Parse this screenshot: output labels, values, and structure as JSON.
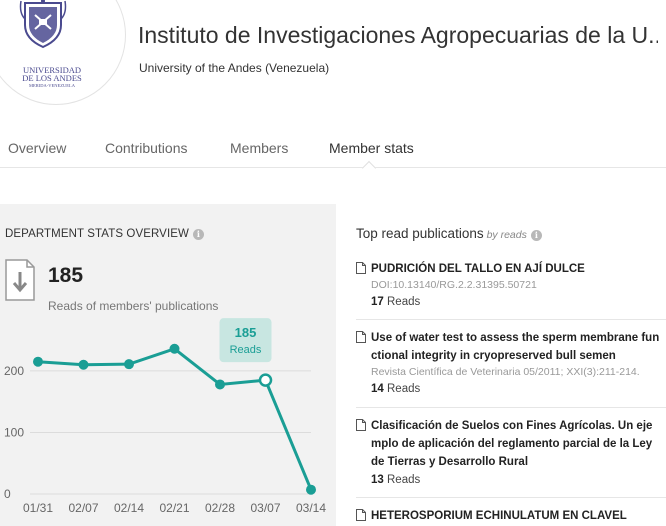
{
  "header": {
    "title": "Instituto de Investigaciones Agropecuarias de la U...",
    "subtitle": "University of the Andes (Venezuela)",
    "logo_text_line1": "UNIVERSIDAD",
    "logo_text_line2": "DE LOS ANDES",
    "logo_text_line3": "MERIDA-VENEZUELA"
  },
  "tabs": [
    {
      "label": "Overview"
    },
    {
      "label": "Contributions"
    },
    {
      "label": "Members"
    },
    {
      "label": "Member stats"
    }
  ],
  "active_tab": "Member stats",
  "stats": {
    "heading": "DEPARTMENT STATS OVERVIEW",
    "reads_count": "185",
    "reads_label": "Reads of members' publications",
    "tooltip_value": "185",
    "tooltip_label": "Reads",
    "accent_color": "#1a9e95",
    "tooltip_bg": "#c8e6e1"
  },
  "chart_data": {
    "type": "line",
    "x": [
      "01/31",
      "02/07",
      "02/14",
      "02/21",
      "02/28",
      "03/07",
      "03/14"
    ],
    "y_ticks": [
      "0",
      "100",
      "200"
    ],
    "ylim": [
      0,
      260
    ],
    "series": [
      {
        "values": [
          215,
          210,
          211,
          236,
          178,
          185,
          7
        ]
      }
    ],
    "highlight_index": 5,
    "grid": true
  },
  "top_publications": {
    "heading": "Top read publications",
    "by_label": "by reads",
    "items": [
      {
        "title": "PUDRICIÓN DEL TALLO EN AJÍ DULCE",
        "meta": "DOI:10.13140/RG.2.2.31395.50721",
        "reads_count": "17",
        "reads_word": "Reads"
      },
      {
        "title": "Use of water test to assess the sperm membrane functional integrity in cryopreserved bull semen",
        "meta": "Revista Científica de Veterinaria 05/2011; XXI(3):211-214.",
        "reads_count": "14",
        "reads_word": "Reads"
      },
      {
        "title": "Clasificación de Suelos con Fines Agrícolas. Un ejemplo de aplicación del reglamento parcial de la Ley de Tierras y Desarrollo Rural",
        "meta": "",
        "reads_count": "13",
        "reads_word": "Reads"
      },
      {
        "title": "HETEROSPORIUM ECHINULATUM EN CLAVEL",
        "meta": "",
        "reads_count": "",
        "reads_word": ""
      }
    ]
  }
}
